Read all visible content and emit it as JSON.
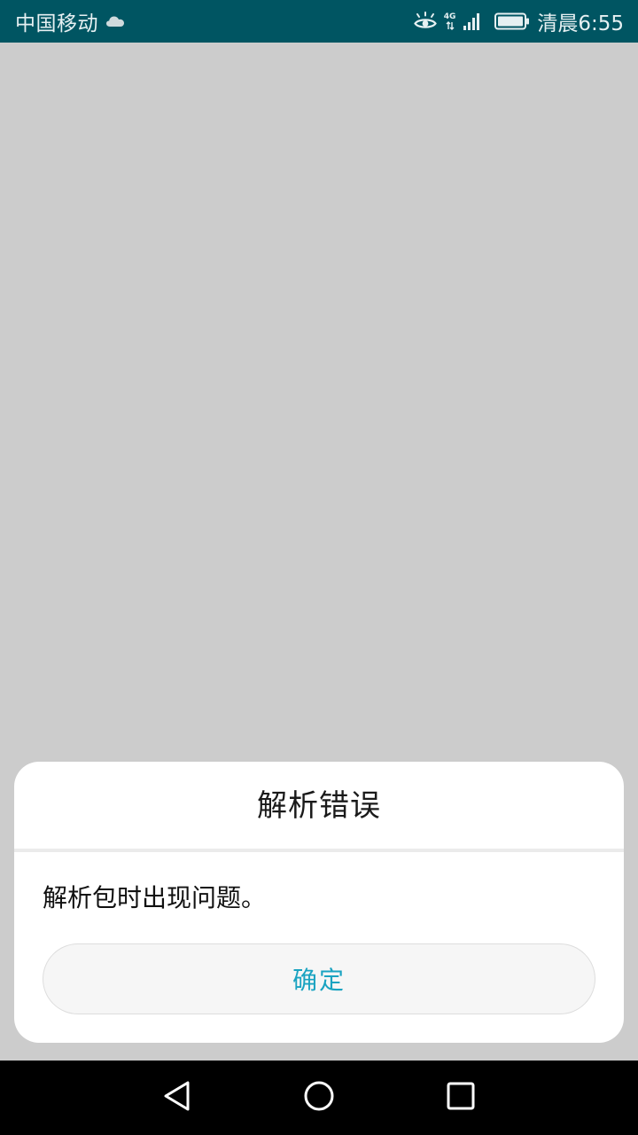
{
  "status_bar": {
    "carrier": "中国移动",
    "network_label": "4G",
    "time": "清晨6:55",
    "icons": [
      "cloud-icon",
      "eye-icon",
      "network-4g-icon",
      "signal-icon",
      "battery-icon"
    ]
  },
  "dialog": {
    "title": "解析错误",
    "message": "解析包时出现问题。",
    "confirm_label": "确定"
  },
  "nav_bar": {
    "icons": [
      "back-icon",
      "home-icon",
      "recent-apps-icon"
    ]
  },
  "colors": {
    "status_bar_bg": "#005562",
    "background": "#cccccc",
    "accent": "#1aa3c1",
    "nav_bar_bg": "#000000"
  }
}
